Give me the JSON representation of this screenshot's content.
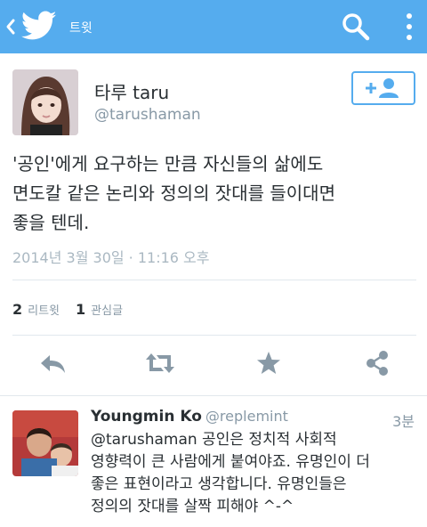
{
  "appbar": {
    "title": "트윗",
    "bg_color": "#55acee",
    "icons": [
      "back-chevron-icon",
      "twitter-bird-icon",
      "search-icon",
      "more-vertical-icon"
    ]
  },
  "tweet": {
    "author_name": "타루 taru",
    "author_handle": "@tarushaman",
    "text_lines": [
      "'공인'에게 요구하는 만큼 자신들의 삶에도",
      "면도칼 같은 논리와 정의의 잣대를 들이대면",
      "좋을 텐데."
    ],
    "timestamp": "2014년 3월 30일 · 11:16 오후",
    "retweet_count": "2",
    "retweet_label": "리트윗",
    "favorite_count": "1",
    "favorite_label": "관심글",
    "actions": [
      "reply-icon",
      "retweet-icon",
      "favorite-star-icon",
      "share-icon"
    ]
  },
  "reply": {
    "name": "Youngmin Ko",
    "handle": "@replemint",
    "time": "3분",
    "text_lines": [
      "@tarushaman 공인은 정치적 사회적",
      "영향력이 큰 사람에게 붙여야죠. 유명인이 더",
      "좋은 표현이라고 생각합니다. 유명인들은",
      "정의의 잣대를 살짝 피해야 ^-^"
    ]
  }
}
